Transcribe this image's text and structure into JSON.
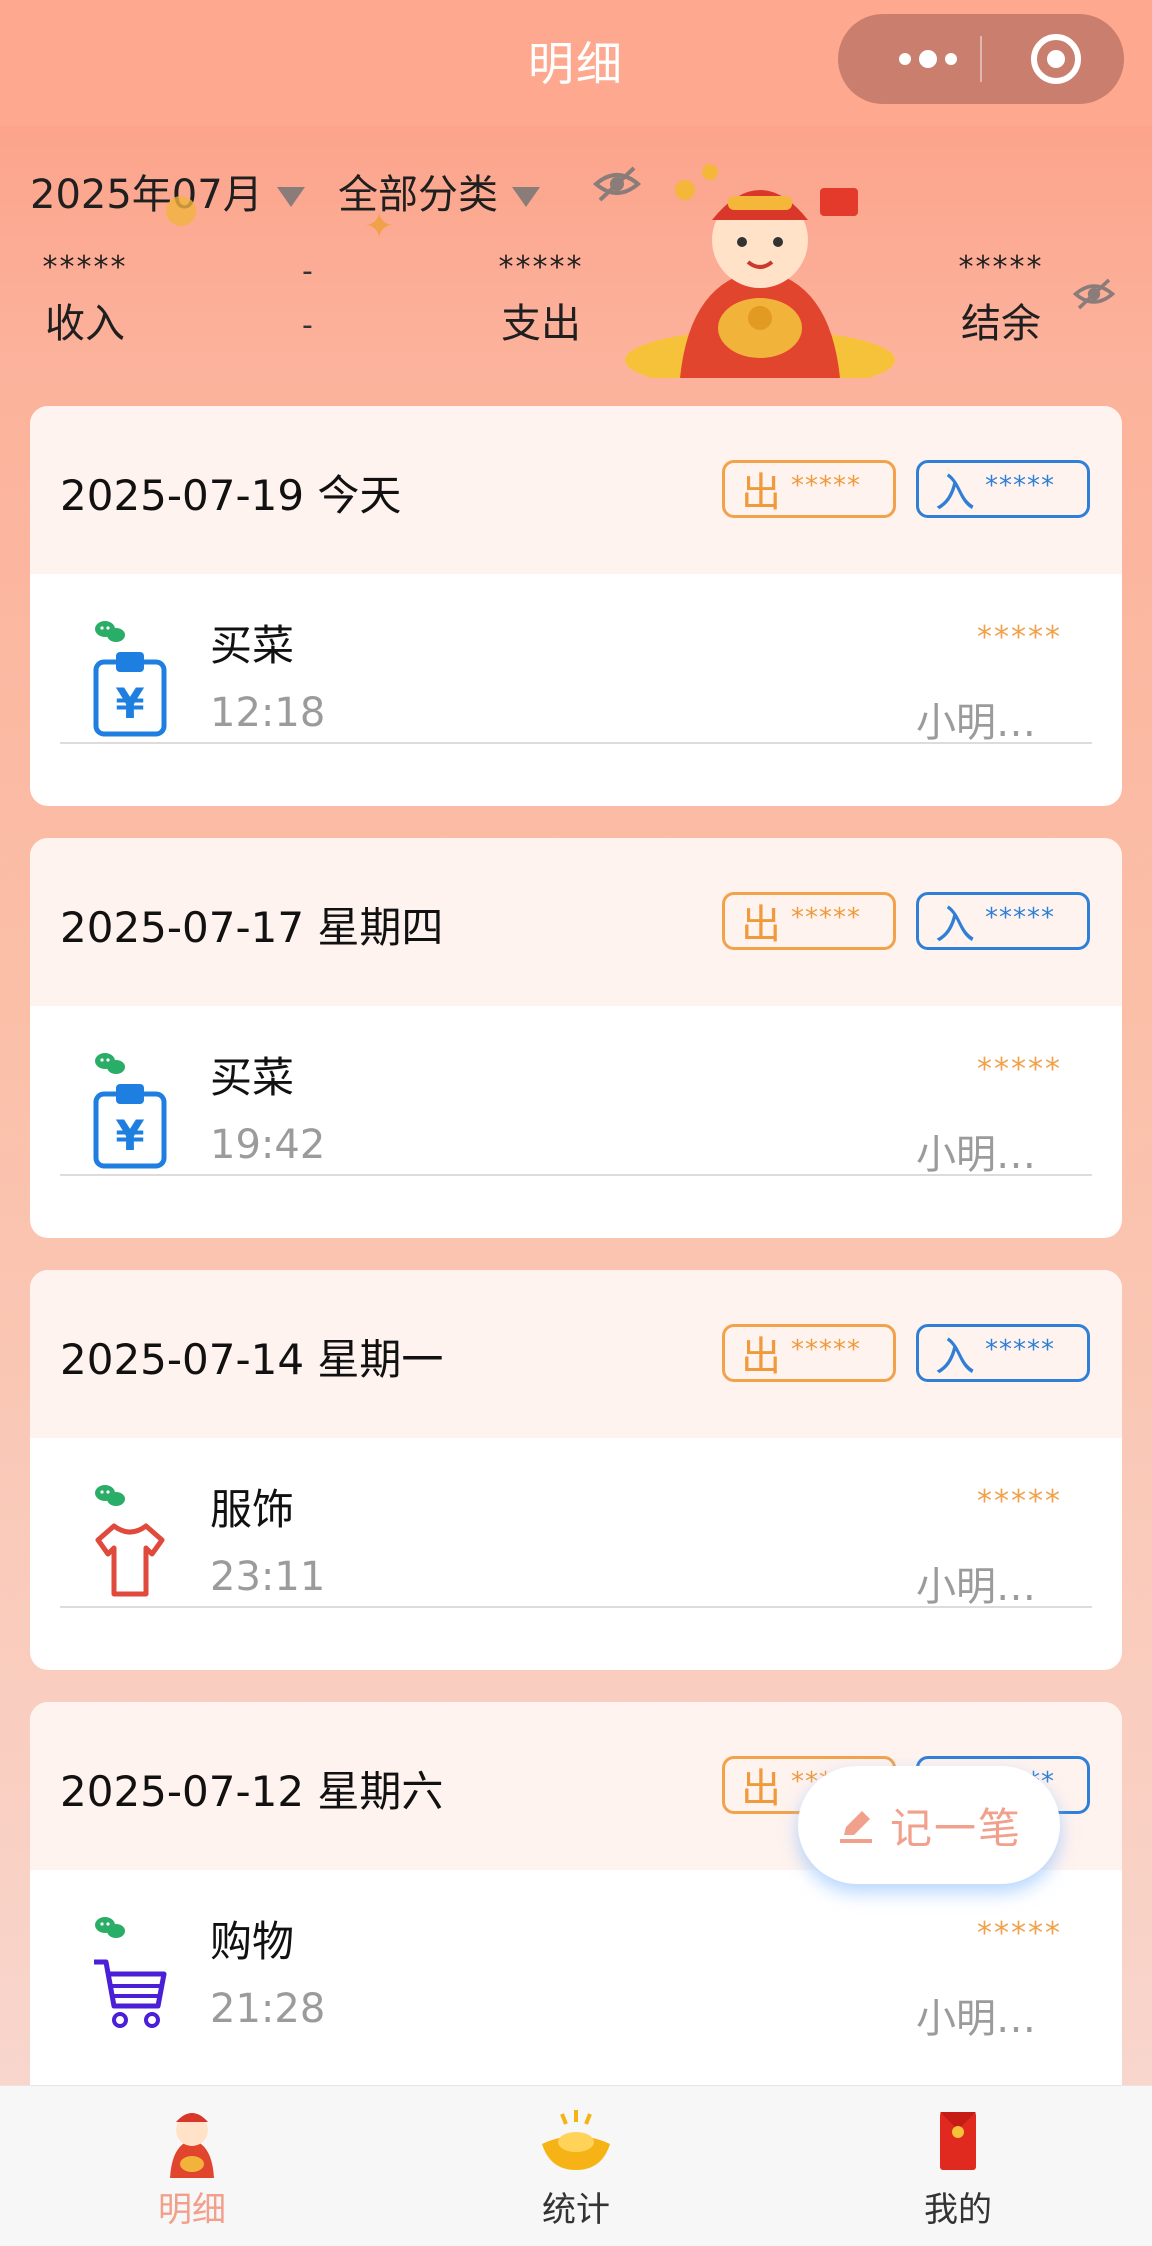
{
  "nav": {
    "title": "明细"
  },
  "filters": {
    "month": "2025年07月",
    "category": "全部分类"
  },
  "summary": {
    "income": {
      "value": "*****",
      "label": "收入"
    },
    "expense": {
      "value": "*****",
      "label": "支出"
    },
    "balance": {
      "value": "*****",
      "label": "结余"
    },
    "sep_top": "-",
    "sep_bottom": "-",
    "sep_right": "="
  },
  "days": [
    {
      "date": "2025-07-19 今天",
      "out_label": "出",
      "out_value": "*****",
      "in_label": "入",
      "in_value": "*****",
      "entries": [
        {
          "icon": "wallet-clipboard-icon",
          "name": "买菜",
          "time": "12:18",
          "amount": "*****",
          "person": "小明…"
        }
      ]
    },
    {
      "date": "2025-07-17 星期四",
      "out_label": "出",
      "out_value": "*****",
      "in_label": "入",
      "in_value": "*****",
      "entries": [
        {
          "icon": "wallet-clipboard-icon",
          "name": "买菜",
          "time": "19:42",
          "amount": "*****",
          "person": "小明…"
        }
      ]
    },
    {
      "date": "2025-07-14 星期一",
      "out_label": "出",
      "out_value": "*****",
      "in_label": "入",
      "in_value": "*****",
      "entries": [
        {
          "icon": "tshirt-icon",
          "name": "服饰",
          "time": "23:11",
          "amount": "*****",
          "person": "小明…"
        }
      ]
    },
    {
      "date": "2025-07-12 星期六",
      "out_label": "出",
      "out_value": "*****",
      "in_label": "入",
      "in_value": "*****",
      "entries": [
        {
          "icon": "shopping-cart-icon",
          "name": "购物",
          "time": "21:28",
          "amount": "*****",
          "person": "小明…"
        }
      ]
    }
  ],
  "fab": {
    "label": "记一笔"
  },
  "tabs": [
    {
      "label": "明细",
      "active": true,
      "icon": "mascot-icon"
    },
    {
      "label": "统计",
      "active": false,
      "icon": "gold-ingot-icon"
    },
    {
      "label": "我的",
      "active": false,
      "icon": "red-envelope-icon"
    }
  ],
  "colors": {
    "accent": "#fda88f",
    "out": "#ef9b3c",
    "in": "#2f7fd6",
    "active_tab": "#f1a08c"
  }
}
